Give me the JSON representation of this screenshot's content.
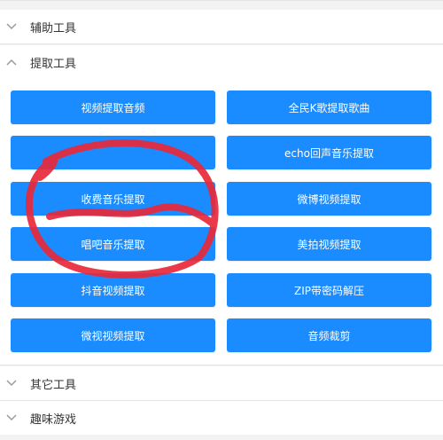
{
  "sections": [
    {
      "title": "辅助工具",
      "expanded": false
    },
    {
      "title": "提取工具",
      "expanded": true
    },
    {
      "title": "其它工具",
      "expanded": false
    },
    {
      "title": "趣味游戏",
      "expanded": false
    }
  ],
  "tools": [
    [
      "视频提取音频",
      "全民K歌提取歌曲"
    ],
    [
      "",
      "echo回声音乐提取"
    ],
    [
      "收费音乐提取",
      "微博视频提取"
    ],
    [
      "唱吧音乐提取",
      "美拍视频提取"
    ],
    [
      "抖音视频提取",
      "ZIP带密码解压"
    ],
    [
      "微视视频提取",
      "音频裁剪"
    ]
  ],
  "colors": {
    "button": "#1a8cff",
    "annotation": "#e8283a",
    "background": "#f3f3f4"
  },
  "icons": {
    "collapsed": "chevron-down-icon",
    "expanded": "chevron-up-icon"
  }
}
